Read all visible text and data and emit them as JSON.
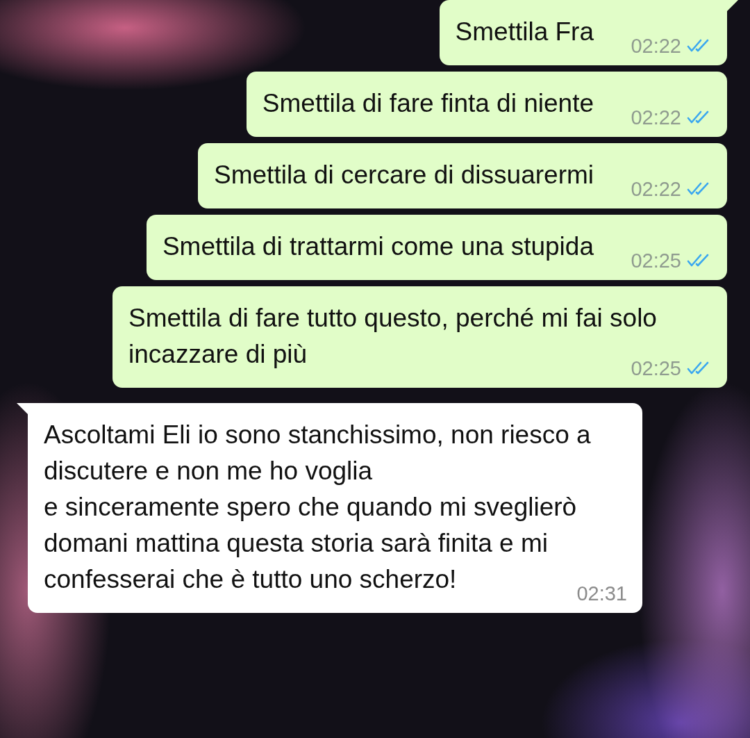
{
  "messages": [
    {
      "kind": "outgoing",
      "text": "Smettila Fra",
      "time": "02:22",
      "read": true,
      "tail": true
    },
    {
      "kind": "outgoing",
      "text": "Smettila di fare finta di niente",
      "time": "02:22",
      "read": true,
      "tail": false
    },
    {
      "kind": "outgoing",
      "text": "Smettila di cercare di dissuarermi",
      "time": "02:22",
      "read": true,
      "tail": false
    },
    {
      "kind": "outgoing",
      "text": "Smettila di trattarmi come una stupida",
      "time": "02:25",
      "read": true,
      "tail": false
    },
    {
      "kind": "outgoing",
      "text": "Smettila di fare tutto questo, perché mi fai solo incazzare di più",
      "time": "02:25",
      "read": true,
      "tail": false
    },
    {
      "kind": "incoming",
      "text": "Ascoltami Eli io sono stanchissimo, non riesco a discutere e non me ho voglia\ne sinceramente spero che quando mi sveglierò domani mattina questa storia sarà finita e mi confesserai che è tutto uno scherzo!",
      "time": "02:31",
      "tail": true
    }
  ]
}
